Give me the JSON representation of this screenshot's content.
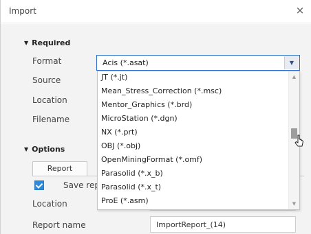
{
  "window": {
    "title": "Import",
    "close_glyph": "×"
  },
  "required": {
    "header": "Required",
    "format_label": "Format",
    "source_label": "Source",
    "location_label": "Location",
    "filename_label": "Filename",
    "format_value": "Acis (*.asat)"
  },
  "format_options": [
    "JT (*.jt)",
    "Mean_Stress_Correction (*.msc)",
    "Mentor_Graphics (*.brd)",
    "MicroStation (*.dgn)",
    "NX (*.prt)",
    "OBJ (*.obj)",
    "OpenMiningFormat (*.omf)",
    "Parasolid (*.x_b)",
    "Parasolid (*.x_t)",
    "ProE (*.asm)"
  ],
  "options": {
    "header": "Options",
    "tab_report": "Report",
    "save_report_label_partial": "Save rep",
    "save_report_checked": true,
    "location_label": "Location",
    "report_name_label": "Report name",
    "report_name_value": "ImportReport_(14)"
  },
  "icons": {
    "caret": "triangle-down-icon",
    "close": "close-icon",
    "combo_arrow": "chevron-down-icon"
  },
  "colors": {
    "accent": "#2e8ad8",
    "focus_border": "#2a6fc9"
  }
}
